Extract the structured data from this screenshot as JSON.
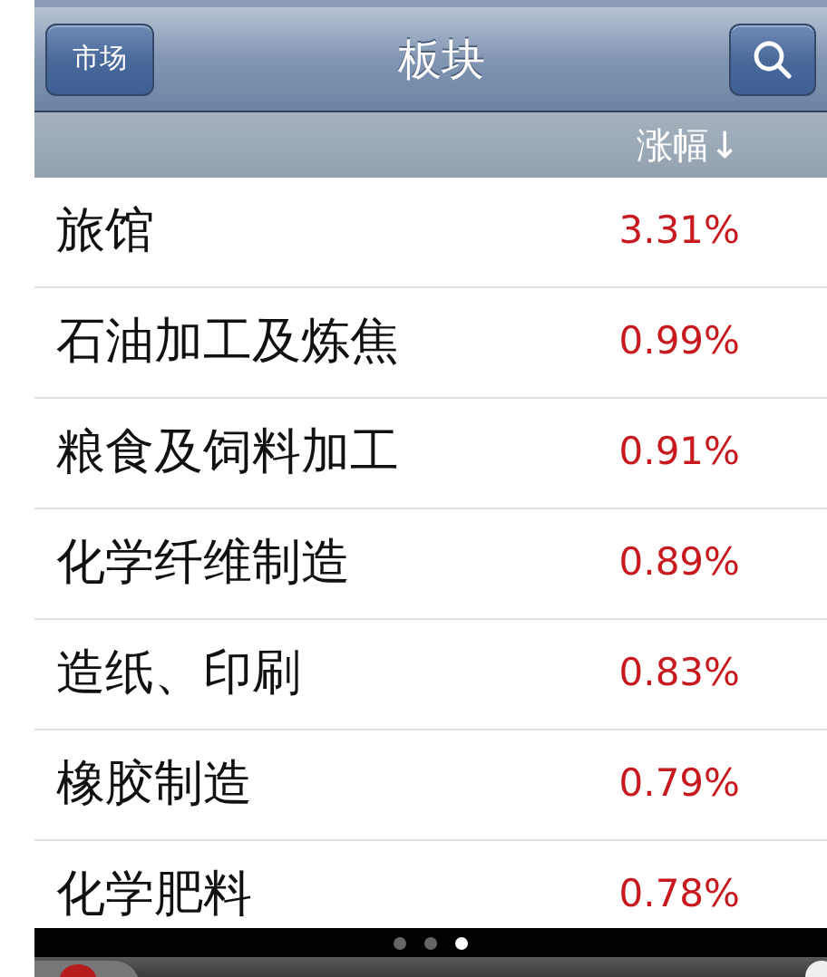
{
  "nav_bar": {
    "back_button": "市场",
    "title": "板块"
  },
  "column_header": {
    "label": "涨幅↓"
  },
  "rows": [
    {
      "name": "旅馆",
      "change": "3.31%"
    },
    {
      "name": "石油加工及炼焦",
      "change": "0.99%"
    },
    {
      "name": "粮食及饲料加工",
      "change": "0.91%"
    },
    {
      "name": "化学纤维制造",
      "change": "0.89%"
    },
    {
      "name": "造纸、印刷",
      "change": "0.83%"
    },
    {
      "name": "橡胶制造",
      "change": "0.79%"
    },
    {
      "name": "化学肥料",
      "change": "0.78%"
    }
  ],
  "page_dots": [
    {
      "selected": false
    },
    {
      "selected": false
    },
    {
      "selected": true
    }
  ]
}
